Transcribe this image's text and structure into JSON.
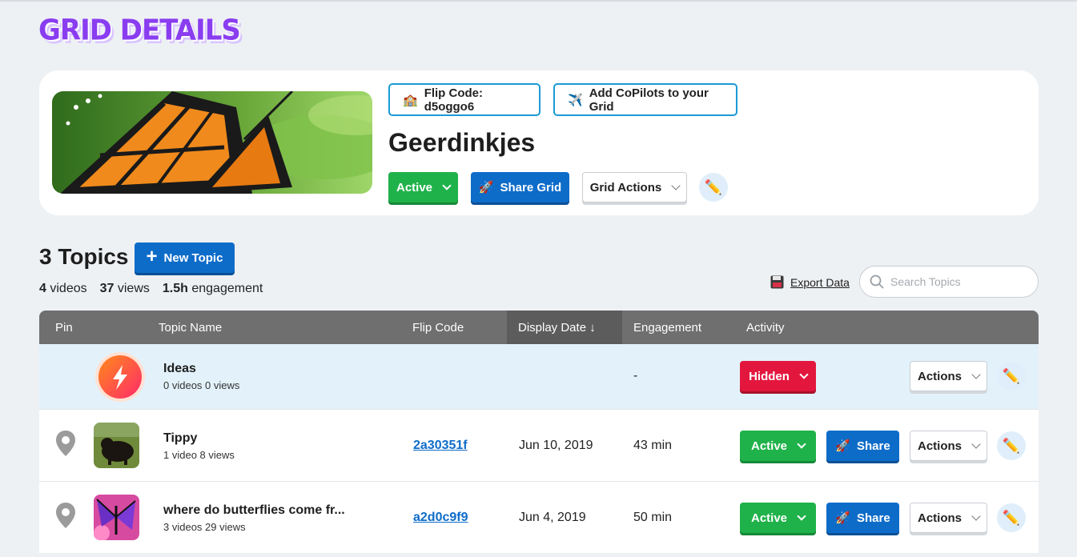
{
  "page": {
    "title": "GRID DETAILS"
  },
  "grid": {
    "flip_code_label": "Flip Code: d5oggo6",
    "copilots_label": "Add CoPilots to your Grid",
    "name": "Geerdinkjes",
    "status_label": "Active",
    "share_label": "Share Grid",
    "actions_label": "Grid Actions"
  },
  "topics_header": {
    "title": "3 Topics",
    "new_topic_label": "New Topic",
    "stats": [
      {
        "value": "4",
        "label": "videos"
      },
      {
        "value": "37",
        "label": "views"
      },
      {
        "value": "1.5h",
        "label": "engagement"
      }
    ],
    "export_label": "Export Data",
    "search_placeholder": "Search Topics"
  },
  "table": {
    "columns": [
      "Pin",
      "Topic Name",
      "Flip Code",
      "Display Date ↓",
      "Engagement",
      "Activity"
    ],
    "rows": [
      {
        "name": "Ideas",
        "meta": "0 videos   0 views",
        "flip_code": "",
        "display_date": "",
        "engagement": "-",
        "status": "Hidden",
        "share": "",
        "actions": "Actions"
      },
      {
        "name": "Tippy",
        "meta": "1 video   8 views",
        "flip_code": "2a30351f",
        "display_date": "Jun 10, 2019",
        "engagement": "43 min",
        "status": "Active",
        "share": "Share",
        "actions": "Actions"
      },
      {
        "name": "where do butterflies come fr...",
        "meta": "3 videos   29 views",
        "flip_code": "a2d0c9f9",
        "display_date": "Jun 4, 2019",
        "engagement": "50 min",
        "status": "Active",
        "share": "Share",
        "actions": "Actions"
      }
    ]
  },
  "colors": {
    "accent_blue": "#0e6cc9",
    "active_green": "#1fb24a",
    "hidden_red": "#e3173e",
    "title_purple": "#8a3df0"
  }
}
